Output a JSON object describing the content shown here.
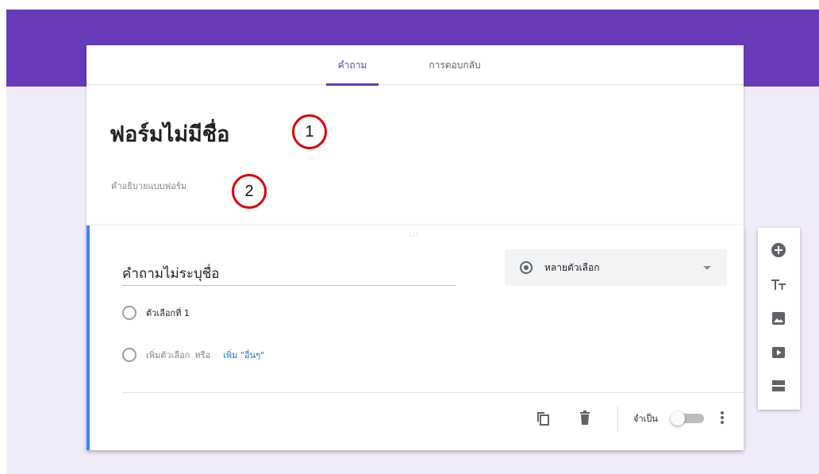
{
  "tabs": {
    "questions": "คำถาม",
    "responses": "การตอบกลับ"
  },
  "form": {
    "title": "ฟอร์มไม่มีชื่อ",
    "description": "คำอธิบายแบบฟอร์ม"
  },
  "annotations": {
    "badge1": "1",
    "badge2": "2"
  },
  "question": {
    "drag_handle": ":::",
    "title": "คำถามไม่ระบุชื่อ",
    "type_label": "หลายตัวเลือก",
    "options": [
      "ตัวเลือกที่ 1"
    ],
    "add_option": "เพิ่มตัวเลือก",
    "or": "หรือ",
    "add_other": "เพิ่ม \"อื่นๆ\"",
    "required_label": "จำเป็น",
    "required": false
  },
  "toolbar": {
    "icons": [
      "add-question-icon",
      "add-title-icon",
      "add-image-icon",
      "add-video-icon",
      "add-section-icon"
    ]
  },
  "colors": {
    "brand": "#673ab7",
    "background": "#f0ebf8",
    "active_card_border": "#4285f4",
    "link": "#1a73e8",
    "annotation": "#e00000"
  }
}
